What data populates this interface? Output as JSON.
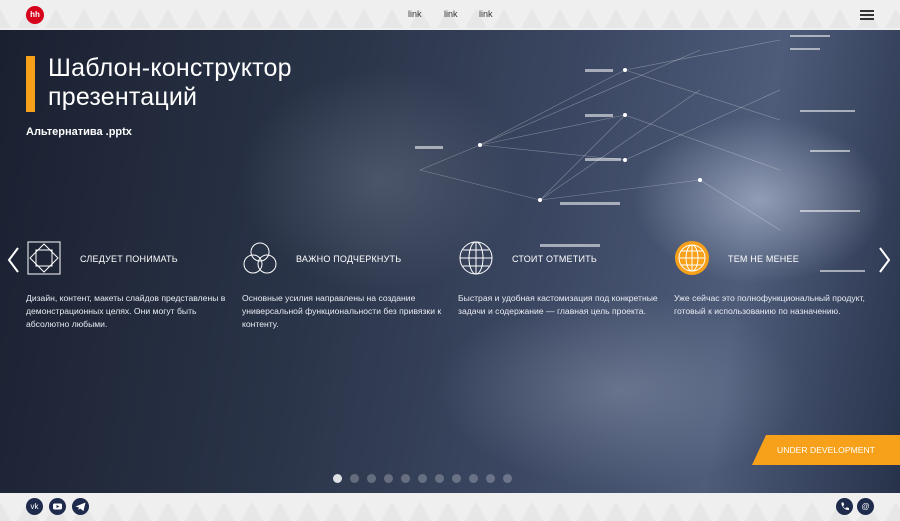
{
  "header": {
    "logo_text": "hh",
    "nav_links": [
      "link",
      "link",
      "link"
    ]
  },
  "hero": {
    "title": "Шаблон-конструктор презентаций",
    "subtitle": "Альтернатива .pptx",
    "features": [
      {
        "icon": "square-diamond-icon",
        "heading": "Следует понимать",
        "text": "Дизайн, контент, макеты слайдов представлены в демонстрационных целях. Они могут быть абсолютно любыми."
      },
      {
        "icon": "three-circles-icon",
        "heading": "Важно подчеркнуть",
        "text": "Основные усилия направлены на создание универсальной функциональности без привязки к контенту."
      },
      {
        "icon": "globe-icon",
        "heading": "Стоит отметить",
        "text": "Быстрая и удобная кастомизация под конкретные задачи и содержание — главная цель проекта."
      },
      {
        "icon": "globe-filled-icon",
        "heading": "Тем не менее",
        "text": "Уже сейчас это полнофункциональный продукт, готовый к использованию по назначению."
      }
    ],
    "badge": "Under development",
    "slide_count": 11,
    "active_slide": 1
  },
  "footer": {
    "social": [
      "vk-icon",
      "youtube-icon",
      "telegram-icon"
    ],
    "contacts": [
      "phone-icon",
      "email-icon"
    ]
  },
  "colors": {
    "accent": "#f7a11a",
    "brand_red": "#d6001c",
    "dark_button": "#1f2b4d"
  }
}
